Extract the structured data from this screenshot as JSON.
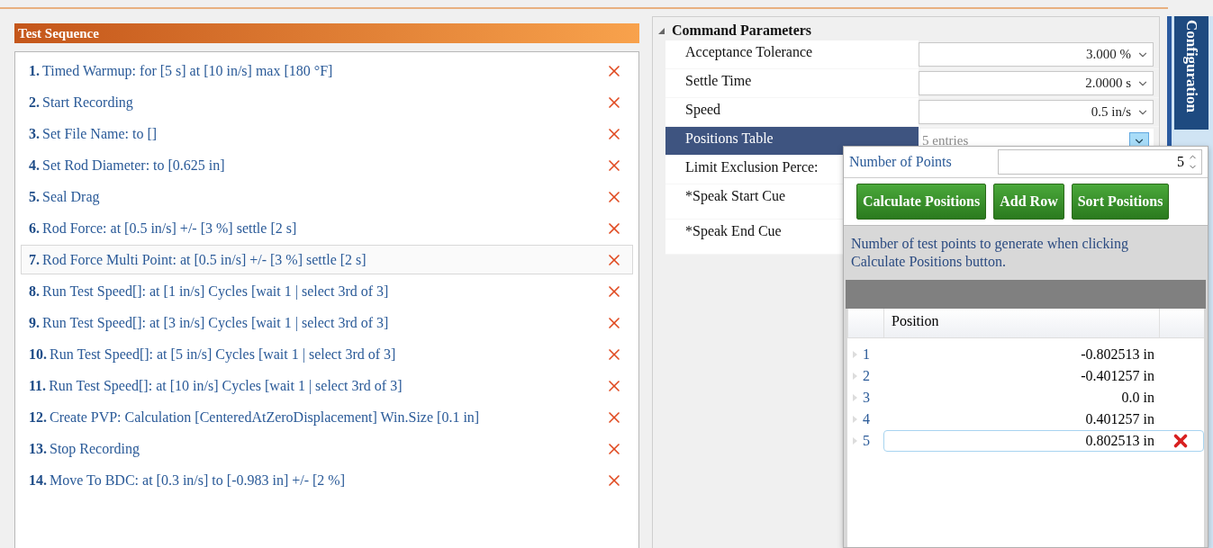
{
  "sequence": {
    "title": "Test Sequence",
    "items": [
      {
        "number": "1.",
        "text": "Timed Warmup: for [5 s] at [10 in/s] max [180 °F]",
        "selected": false
      },
      {
        "number": "2.",
        "text": "Start Recording",
        "selected": false
      },
      {
        "number": "3.",
        "text": "Set File Name: to []",
        "selected": false
      },
      {
        "number": "4.",
        "text": "Set Rod Diameter: to [0.625 in]",
        "selected": false
      },
      {
        "number": "5.",
        "text": "Seal Drag",
        "selected": false
      },
      {
        "number": "6.",
        "text": "Rod Force: at [0.5 in/s] +/- [3 %] settle [2 s]",
        "selected": false
      },
      {
        "number": "7.",
        "text": "Rod Force Multi Point: at [0.5 in/s] +/- [3 %] settle [2 s]",
        "selected": true
      },
      {
        "number": "8.",
        "text": "Run Test Speed[]: at [1 in/s] Cycles [wait 1  |  select 3rd of 3]",
        "selected": false
      },
      {
        "number": "9.",
        "text": "Run Test Speed[]: at [3 in/s] Cycles [wait 1  |  select 3rd of 3]",
        "selected": false
      },
      {
        "number": "10.",
        "text": "Run Test Speed[]: at [5 in/s] Cycles [wait 1  |  select 3rd of 3]",
        "selected": false
      },
      {
        "number": "11.",
        "text": "Run Test Speed[]: at [10 in/s] Cycles [wait 1  |  select 3rd of 3]",
        "selected": false
      },
      {
        "number": "12.",
        "text": "Create PVP: Calculation [CenteredAtZeroDisplacement] Win.Size [0.1 in]",
        "selected": false
      },
      {
        "number": "13.",
        "text": "Stop Recording",
        "selected": false
      },
      {
        "number": "14.",
        "text": "Move To BDC: at [0.3 in/s] to [-0.983 in] +/- [2 %]",
        "selected": false
      }
    ]
  },
  "parameters": {
    "title": "Command Parameters",
    "expanded": true,
    "rows": [
      {
        "label": "Acceptance Tolerance",
        "kind": "dropdown",
        "value": "3.000 %",
        "selected": false
      },
      {
        "label": "Settle Time",
        "kind": "dropdown",
        "value": "2.0000 s",
        "selected": false
      },
      {
        "label": "Speed",
        "kind": "dropdown",
        "value": "0.5 in/s",
        "selected": false
      },
      {
        "label": "Positions Table",
        "kind": "table",
        "value": "5 entries",
        "selected": true
      },
      {
        "label": "Limit Exclusion Perce:",
        "kind": "plain",
        "selected": false
      },
      {
        "label": "*Speak Start Cue",
        "kind": "plain",
        "selected": false
      },
      {
        "label": "*Speak End Cue",
        "kind": "plain",
        "selected": false
      }
    ]
  },
  "side_tab": {
    "label": "Configuration"
  },
  "positions_popup": {
    "points_label": "Number of Points",
    "points_value": "5",
    "buttons": [
      "Calculate Positions",
      "Add Row",
      "Sort Positions"
    ],
    "description": "Number of test points to generate when clicking Calculate Positions button.",
    "column": "Position",
    "rows": [
      {
        "index": "1",
        "value": "-0.802513 in",
        "selected": false
      },
      {
        "index": "2",
        "value": "-0.401257 in",
        "selected": false
      },
      {
        "index": "3",
        "value": "0.0 in",
        "selected": false
      },
      {
        "index": "4",
        "value": "0.401257 in",
        "selected": false
      },
      {
        "index": "5",
        "value": "0.802513 in",
        "selected": true
      }
    ]
  }
}
